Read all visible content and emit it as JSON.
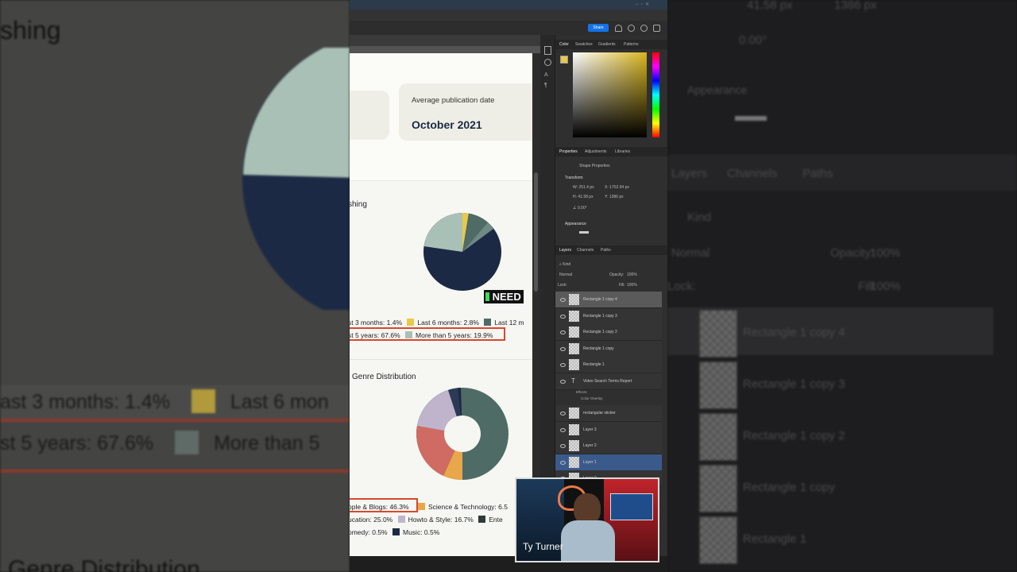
{
  "photoshop": {
    "share_label": "Share",
    "color_panel": {
      "tabs": [
        "Color",
        "Swatches",
        "Gradients",
        "Patterns"
      ]
    },
    "properties_panel": {
      "tabs": [
        "Properties",
        "Adjustments",
        "Libraries"
      ],
      "shape_properties": "Shape Properties",
      "transform_label": "Transform",
      "w": "251.4 px",
      "x": "1702.94 px",
      "h": "41.58 px",
      "y": "1386 px",
      "angle": "0.00°",
      "appearance_label": "Appearance"
    },
    "layers_panel": {
      "tabs": [
        "Layers",
        "Channels",
        "Paths"
      ],
      "filter_kind": "Kind",
      "blend_mode": "Normal",
      "opacity_label": "Opacity:",
      "opacity": "100%",
      "lock_label": "Lock:",
      "fill_label": "Fill:",
      "fill": "100%",
      "layers": [
        {
          "name": "Rectangle 1 copy 4",
          "state": "highlighted"
        },
        {
          "name": "Rectangle 1 copy 3"
        },
        {
          "name": "Rectangle 1 copy 2"
        },
        {
          "name": "Rectangle 1 copy"
        },
        {
          "name": "Rectangle 1"
        },
        {
          "name": "Video Search Terms Report",
          "type": "text",
          "effects": [
            "Effects",
            "Color Overlay"
          ]
        },
        {
          "name": "rectangular sticker"
        },
        {
          "name": "Layer 3"
        },
        {
          "name": "Layer 2"
        },
        {
          "name": "Layer 1",
          "state": "selected"
        },
        {
          "name": "Layer 0"
        }
      ]
    }
  },
  "document": {
    "stat_card": {
      "label": "Average publication date",
      "value": "October 2021"
    },
    "publishing_chart": {
      "title_fragment": "shing",
      "legend_row1": [
        "st 3 months: 1.4%",
        "Last 6 months: 2.8%",
        "Last 12 m"
      ],
      "legend_row2": [
        "st 5 years: 67.6%",
        "More than 5 years: 19.9%"
      ]
    },
    "genre_chart": {
      "title": "Genre Distribution",
      "legend_row1": [
        "ople & Blogs: 46.3%",
        "Science & Technology: 6.5"
      ],
      "legend_row2": [
        "ucation: 25.0%",
        "Howto & Style: 16.7%",
        "Ente"
      ],
      "legend_row3": [
        "omedy: 0.5%",
        "Music: 0.5%"
      ]
    }
  },
  "caption_word": "NEED",
  "presenter_name": "Ty Turner",
  "background_blur": {
    "left_title": "shing",
    "left_legend1": [
      "ast 3 months: 1.4%",
      "Last 6 mon"
    ],
    "left_legend2": [
      "st 5 years: 67.6%",
      "More than 5"
    ],
    "left_bottom": "Genre Distribution",
    "right_w": "41.58 px",
    "right_y": "1386 px",
    "right_angle": "0.00°",
    "right_appearance": "Appearance",
    "right_tabs": [
      "Layers",
      "Channels",
      "Paths"
    ],
    "right_kind": "Kind",
    "right_blend": "Normal",
    "right_opacity_label": "Opacity:",
    "right_opacity": "100%",
    "right_lock": "Lock:",
    "right_fill_label": "Fill:",
    "right_fill": "100%",
    "right_layers": [
      "Rectangle 1 copy 4",
      "Rectangle 1 copy 3",
      "Rectangle 1 copy 2",
      "Rectangle 1 copy",
      "Rectangle 1"
    ]
  },
  "colors": {
    "navy": "#1b2945",
    "teal": "#4f6b66",
    "sage": "#a9c0b6",
    "yellow": "#e8c94a",
    "orange": "#e9a64a",
    "coral": "#cf6b63",
    "lavender": "#bfb4cc",
    "highlight_red": "#d9472f",
    "ps_blue": "#1473e6"
  }
}
